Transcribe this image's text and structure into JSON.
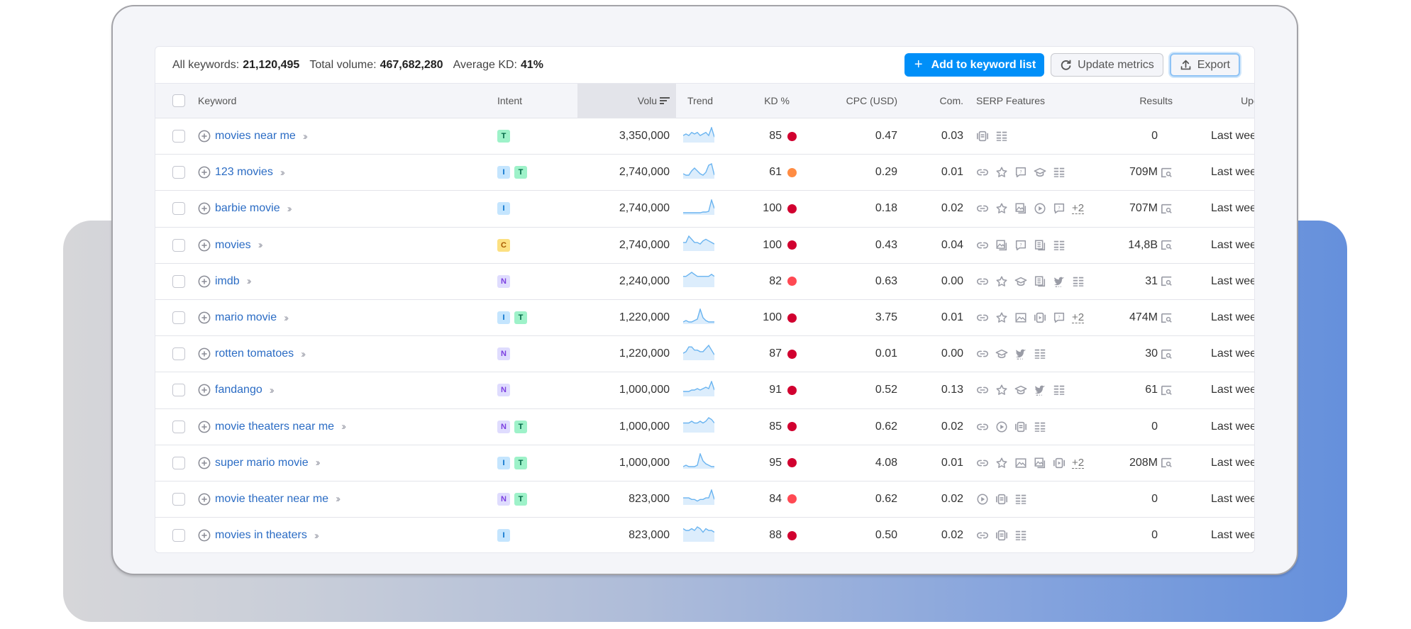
{
  "summary": {
    "all_keywords_label": "All keywords:",
    "all_keywords_value": "21,120,495",
    "total_volume_label": "Total volume:",
    "total_volume_value": "467,682,280",
    "avg_kd_label": "Average KD:",
    "avg_kd_value": "41%"
  },
  "toolbar": {
    "add_label": "Add to keyword list",
    "update_label": "Update metrics",
    "export_label": "Export"
  },
  "columns": {
    "keyword": "Keyword",
    "intent": "Intent",
    "volume": "Volu",
    "trend": "Trend",
    "kd": "KD %",
    "cpc": "CPC (USD)",
    "com": "Com.",
    "serp": "SERP Features",
    "results": "Results",
    "updated": "Updated"
  },
  "colors": {
    "accent": "#008ff8",
    "link": "#2b6cc4",
    "kd_very_hard": "#d1002f",
    "kd_hard": "#ff4953",
    "kd_difficult": "#ff8c43",
    "trend_line": "#6ab4f0",
    "trend_fill": "#dcedfc"
  },
  "rows": [
    {
      "keyword": "movies near me",
      "intent": [
        "T"
      ],
      "volume": "3,350,000",
      "trend": [
        4,
        5,
        4,
        6,
        5,
        6,
        4,
        5,
        6,
        4,
        9,
        3
      ],
      "kd": "85",
      "kd_level": "very_hard",
      "cpc": "0.47",
      "com": "0.03",
      "serp": [
        "carousel-icon",
        "list-icon"
      ],
      "serp_more": "",
      "results": "0",
      "results_icon": false,
      "updated": "Last week"
    },
    {
      "keyword": "123 movies",
      "intent": [
        "I",
        "T"
      ],
      "volume": "2,740,000",
      "trend": [
        3,
        2,
        2,
        5,
        7,
        5,
        3,
        2,
        4,
        9,
        10,
        2
      ],
      "kd": "61",
      "kd_level": "difficult",
      "cpc": "0.29",
      "com": "0.01",
      "serp": [
        "link-icon",
        "star-icon",
        "faq-icon",
        "education-icon",
        "list-icon"
      ],
      "serp_more": "",
      "results": "709M",
      "results_icon": true,
      "updated": "Last week"
    },
    {
      "keyword": "barbie movie",
      "intent": [
        "I"
      ],
      "volume": "2,740,000",
      "trend": [
        1,
        1,
        1,
        1,
        1,
        1,
        1,
        1.5,
        1.5,
        2,
        10,
        4
      ],
      "kd": "100",
      "kd_level": "very_hard",
      "cpc": "0.18",
      "com": "0.02",
      "serp": [
        "link-icon",
        "star-icon",
        "images-icon",
        "video-icon",
        "faq-icon"
      ],
      "serp_more": "+2",
      "results": "707M",
      "results_icon": true,
      "updated": "Last week"
    },
    {
      "keyword": "movies",
      "intent": [
        "C"
      ],
      "volume": "2,740,000",
      "trend": [
        5,
        5,
        9,
        7,
        5,
        5,
        4,
        6,
        7,
        6,
        5,
        4
      ],
      "kd": "100",
      "kd_level": "very_hard",
      "cpc": "0.43",
      "com": "0.04",
      "serp": [
        "link-icon",
        "images-icon",
        "faq-icon",
        "news-icon",
        "list-icon"
      ],
      "serp_more": "",
      "results": "14,8B",
      "results_icon": true,
      "updated": "Last week"
    },
    {
      "keyword": "imdb",
      "intent": [
        "N"
      ],
      "volume": "2,240,000",
      "trend": [
        5,
        5,
        6,
        7,
        6,
        5,
        5,
        5,
        5,
        5,
        6,
        5
      ],
      "kd": "82",
      "kd_level": "hard",
      "cpc": "0.63",
      "com": "0.00",
      "serp": [
        "link-icon",
        "star-icon",
        "education-icon",
        "news-icon",
        "twitter-icon",
        "list-icon"
      ],
      "serp_more": "",
      "results": "31",
      "results_icon": true,
      "updated": "Last week"
    },
    {
      "keyword": "mario movie",
      "intent": [
        "I",
        "T"
      ],
      "volume": "1,220,000",
      "trend": [
        1,
        2,
        1,
        1,
        2,
        3,
        10,
        4,
        2,
        1,
        1,
        1
      ],
      "kd": "100",
      "kd_level": "very_hard",
      "cpc": "3.75",
      "com": "0.01",
      "serp": [
        "link-icon",
        "star-icon",
        "image-icon",
        "video-carousel-icon",
        "faq-icon"
      ],
      "serp_more": "+2",
      "results": "474M",
      "results_icon": true,
      "updated": "Last week"
    },
    {
      "keyword": "rotten tomatoes",
      "intent": [
        "N"
      ],
      "volume": "1,220,000",
      "trend": [
        4,
        5,
        8,
        8,
        6,
        6,
        5,
        5,
        7,
        9,
        6,
        3
      ],
      "kd": "87",
      "kd_level": "very_hard",
      "cpc": "0.01",
      "com": "0.00",
      "serp": [
        "link-icon",
        "education-icon",
        "twitter-icon",
        "list-icon"
      ],
      "serp_more": "",
      "results": "30",
      "results_icon": true,
      "updated": "Last week"
    },
    {
      "keyword": "fandango",
      "intent": [
        "N"
      ],
      "volume": "1,000,000",
      "trend": [
        3,
        3,
        3,
        4,
        4,
        5,
        4,
        5,
        6,
        5,
        10,
        4
      ],
      "kd": "91",
      "kd_level": "very_hard",
      "cpc": "0.52",
      "com": "0.13",
      "serp": [
        "link-icon",
        "star-icon",
        "education-icon",
        "twitter-icon",
        "list-icon"
      ],
      "serp_more": "",
      "results": "61",
      "results_icon": true,
      "updated": "Last week"
    },
    {
      "keyword": "movie theaters near me",
      "intent": [
        "N",
        "T"
      ],
      "volume": "1,000,000",
      "trend": [
        5,
        5,
        5,
        6,
        5,
        5,
        6,
        5,
        6,
        8,
        7,
        5
      ],
      "kd": "85",
      "kd_level": "very_hard",
      "cpc": "0.62",
      "com": "0.02",
      "serp": [
        "link-icon",
        "video-icon",
        "carousel-icon",
        "list-icon"
      ],
      "serp_more": "",
      "results": "0",
      "results_icon": false,
      "updated": "Last week"
    },
    {
      "keyword": "super mario movie",
      "intent": [
        "I",
        "T"
      ],
      "volume": "1,000,000",
      "trend": [
        1,
        2,
        1,
        1,
        1,
        2,
        10,
        5,
        3,
        2,
        1,
        1
      ],
      "kd": "95",
      "kd_level": "very_hard",
      "cpc": "4.08",
      "com": "0.01",
      "serp": [
        "link-icon",
        "star-icon",
        "image-icon",
        "images-icon",
        "video-carousel-icon"
      ],
      "serp_more": "+2",
      "results": "208M",
      "results_icon": true,
      "updated": "Last week"
    },
    {
      "keyword": "movie theater near me",
      "intent": [
        "N",
        "T"
      ],
      "volume": "823,000",
      "trend": [
        4,
        4,
        4,
        3,
        3,
        2,
        3,
        3,
        4,
        4,
        9,
        3
      ],
      "kd": "84",
      "kd_level": "hard",
      "cpc": "0.62",
      "com": "0.02",
      "serp": [
        "video-icon",
        "carousel-icon",
        "list-icon"
      ],
      "serp_more": "",
      "results": "0",
      "results_icon": false,
      "updated": "Last week"
    },
    {
      "keyword": "movies in theaters",
      "intent": [
        "I"
      ],
      "volume": "823,000",
      "trend": [
        7,
        6,
        6,
        7,
        6,
        8,
        7,
        5,
        7,
        6,
        6,
        5
      ],
      "kd": "88",
      "kd_level": "very_hard",
      "cpc": "0.50",
      "com": "0.02",
      "serp": [
        "link-icon",
        "carousel-icon",
        "list-icon"
      ],
      "serp_more": "",
      "results": "0",
      "results_icon": false,
      "updated": "Last week"
    }
  ]
}
